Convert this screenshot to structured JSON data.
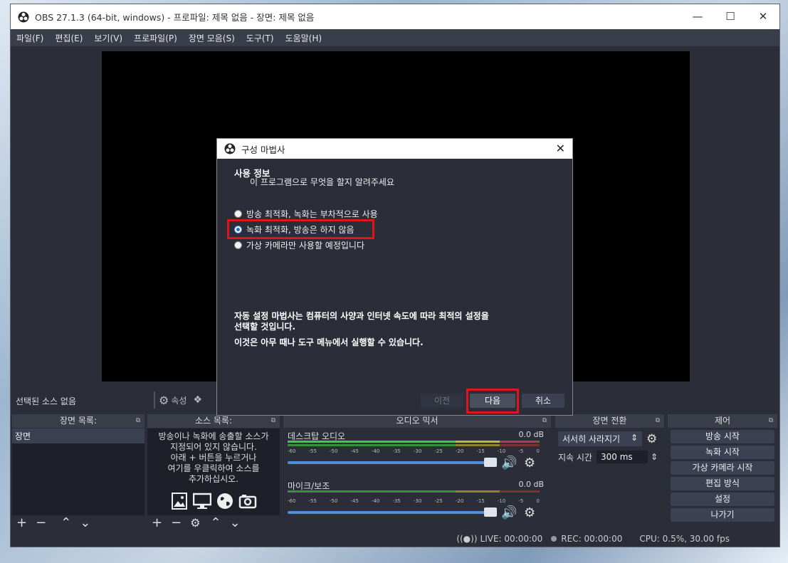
{
  "window": {
    "title": "OBS 27.1.3 (64-bit, windows) - 프로파일: 제목 없음 - 장면: 제목 없음",
    "controls": [
      "minimize",
      "maximize",
      "close"
    ]
  },
  "menu": [
    "파일(F)",
    "편집(E)",
    "보기(V)",
    "프로파일(P)",
    "장면 모음(S)",
    "도구(T)",
    "도움말(H)"
  ],
  "source_bar": {
    "label": "선택된 소스 없음",
    "properties": "속성"
  },
  "docks": {
    "scenes": {
      "header": "장면 목록:",
      "items": [
        "장면"
      ]
    },
    "sources": {
      "header": "소스 목록:",
      "empty_lines": [
        "방송이나 녹화에 송출할 소스가",
        "지정되어 있지 않습니다.",
        "아래 + 버튼을 누르거나",
        "여기를 우클릭하여 소스를",
        "추가하십시오."
      ]
    },
    "mixer": {
      "header": "오디오 믹서",
      "tracks": [
        {
          "name": "데스크탑 오디오",
          "db": "0.0 dB",
          "volume": 1.0
        },
        {
          "name": "마이크/보조",
          "db": "0.0 dB",
          "volume": 1.0
        }
      ],
      "ticks": [
        "-60",
        "-55",
        "-50",
        "-45",
        "-40",
        "-35",
        "-30",
        "-25",
        "-20",
        "-15",
        "-10",
        "-5",
        "0"
      ]
    },
    "transitions": {
      "header": "장면 전환",
      "type": "서서히 사라지기",
      "duration_label": "지속 시간",
      "duration": "300 ms"
    },
    "controls": {
      "header": "제어",
      "buttons": [
        "방송 시작",
        "녹화 시작",
        "가상 카메라 시작",
        "편집 방식",
        "설정",
        "나가기"
      ]
    }
  },
  "status": {
    "live": "LIVE: 00:00:00",
    "rec": "REC: 00:00:00",
    "cpu": "CPU: 0.5%, 30.00 fps"
  },
  "dialog": {
    "title": "구성 마법사",
    "heading": "사용 정보",
    "subheading": "이 프로그램으로 무엇을 할지 알려주세요",
    "options": [
      {
        "label": "방송 최적화, 녹화는 부차적으로 사용",
        "selected": false
      },
      {
        "label": "녹화 최적화, 방송은 하지 않음",
        "selected": true
      },
      {
        "label": "가상 카메라만 사용할 예정입니다",
        "selected": false
      }
    ],
    "info_line1": "자동 설정 마법사는 컴퓨터의 사양과 인터넷 속도에 따라 최적의 설정을",
    "info_line2": "선택할 것입니다.",
    "info_line3": "이것은 아무 때나 도구 메뉴에서 실행할 수 있습니다.",
    "buttons": {
      "back": "이전",
      "next": "다음",
      "cancel": "취소"
    }
  }
}
